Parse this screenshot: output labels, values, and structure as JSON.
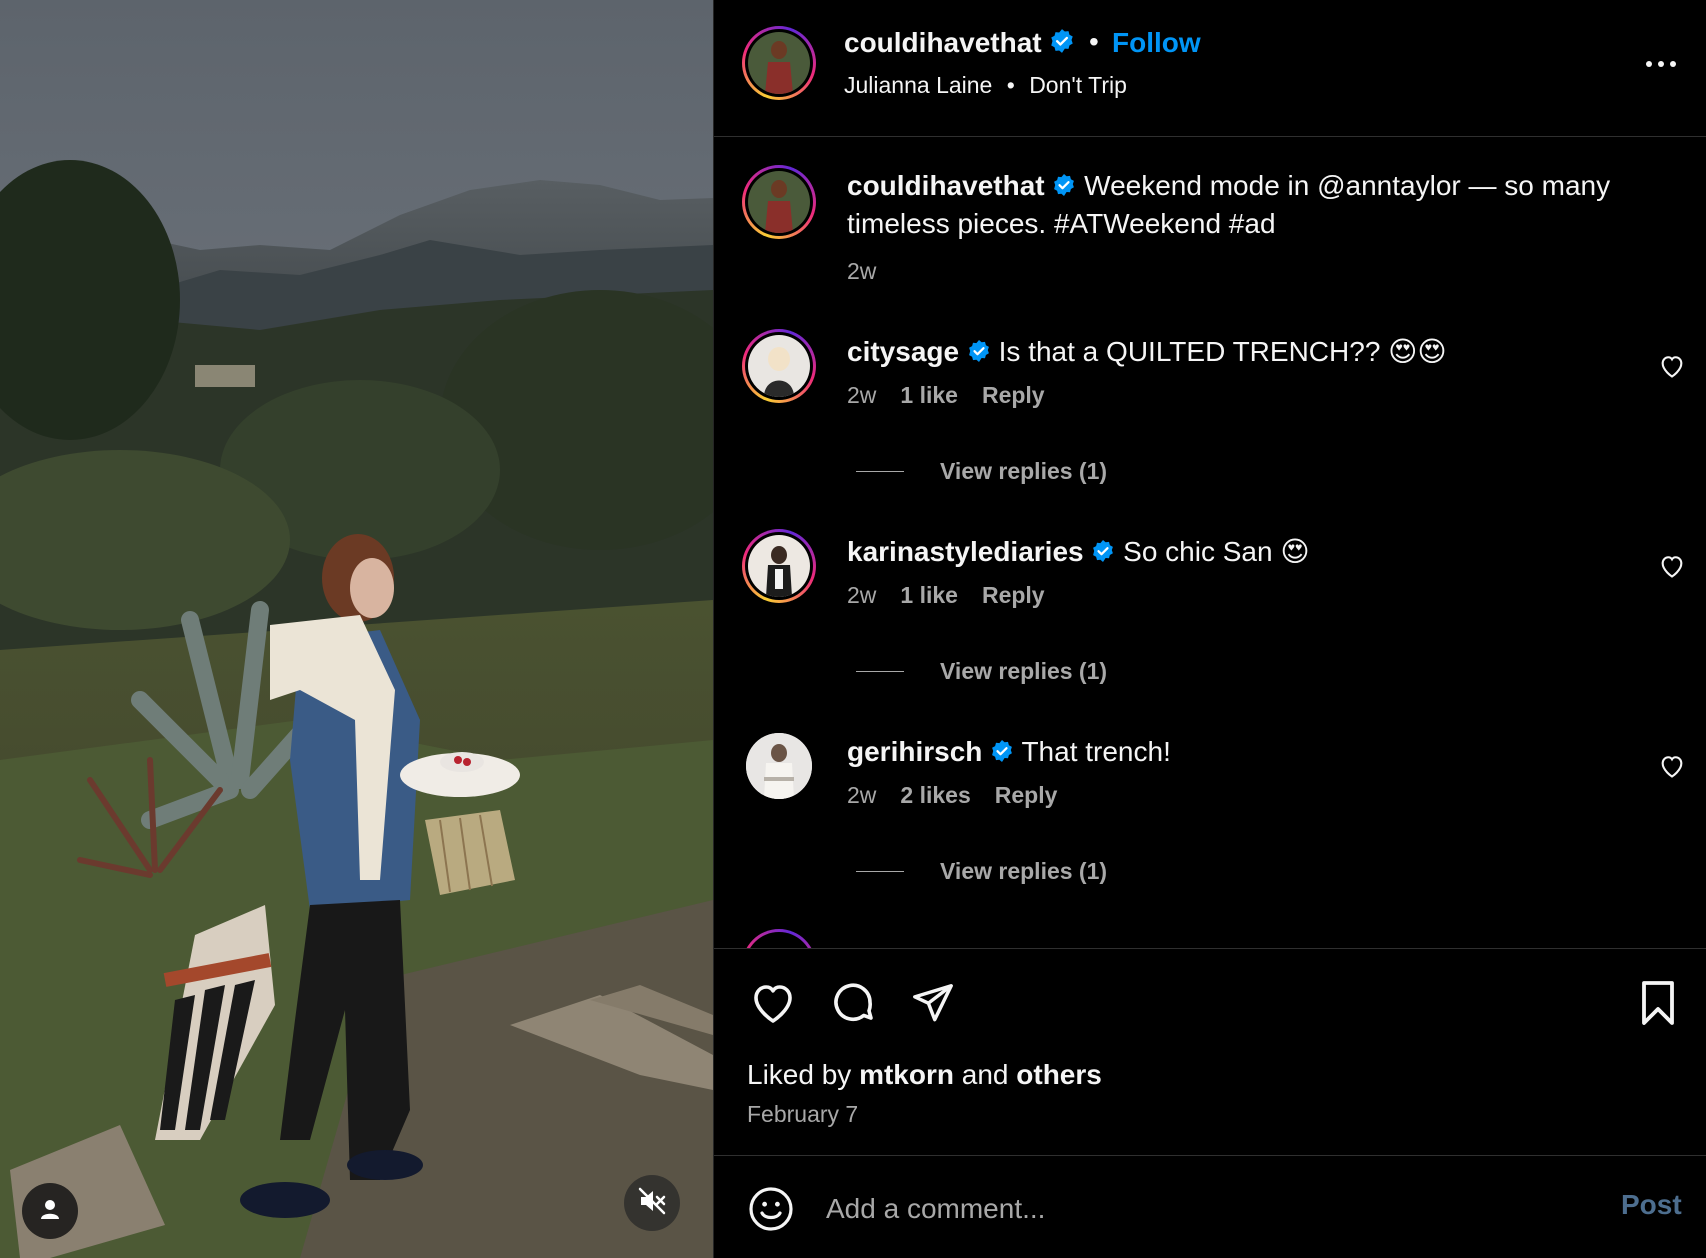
{
  "post": {
    "username": "couldihavethat",
    "follow_label": "Follow",
    "separator": "•",
    "audio_artist": "Julianna Laine",
    "audio_track": "Don't Trip"
  },
  "caption": {
    "username": "couldihavethat",
    "text": "Weekend mode in @anntaylor — so many timeless pieces. #ATWeekend #ad",
    "time": "2w"
  },
  "comments": [
    {
      "username": "citysage",
      "text": "Is that a QUILTED TRENCH?? 😍😍",
      "time": "2w",
      "likes": "1 like",
      "reply_label": "Reply",
      "view_replies": "View replies (1)"
    },
    {
      "username": "karinastylediaries",
      "text": "So chic San 😍",
      "time": "2w",
      "likes": "1 like",
      "reply_label": "Reply",
      "view_replies": "View replies (1)"
    },
    {
      "username": "gerihirsch",
      "text": "That trench!",
      "time": "2w",
      "likes": "2 likes",
      "reply_label": "Reply",
      "view_replies": "View replies (1)"
    }
  ],
  "engagement": {
    "liked_by_prefix": "Liked by",
    "liked_by_user": "mtkorn",
    "liked_by_and": "and",
    "liked_by_others": "others",
    "date": "February 7"
  },
  "composer": {
    "placeholder": "Add a comment...",
    "post_label": "Post"
  },
  "colors": {
    "accent": "#0095f6",
    "verified": "#0095f6",
    "muted_text": "#a8a8a8",
    "post_disabled": "#4d6e8f"
  },
  "icons": [
    "heart-icon",
    "comment-icon",
    "share-icon",
    "bookmark-icon",
    "more-icon",
    "emoji-icon",
    "person-tag-icon",
    "muted-speaker-icon",
    "verified-badge-icon"
  ]
}
